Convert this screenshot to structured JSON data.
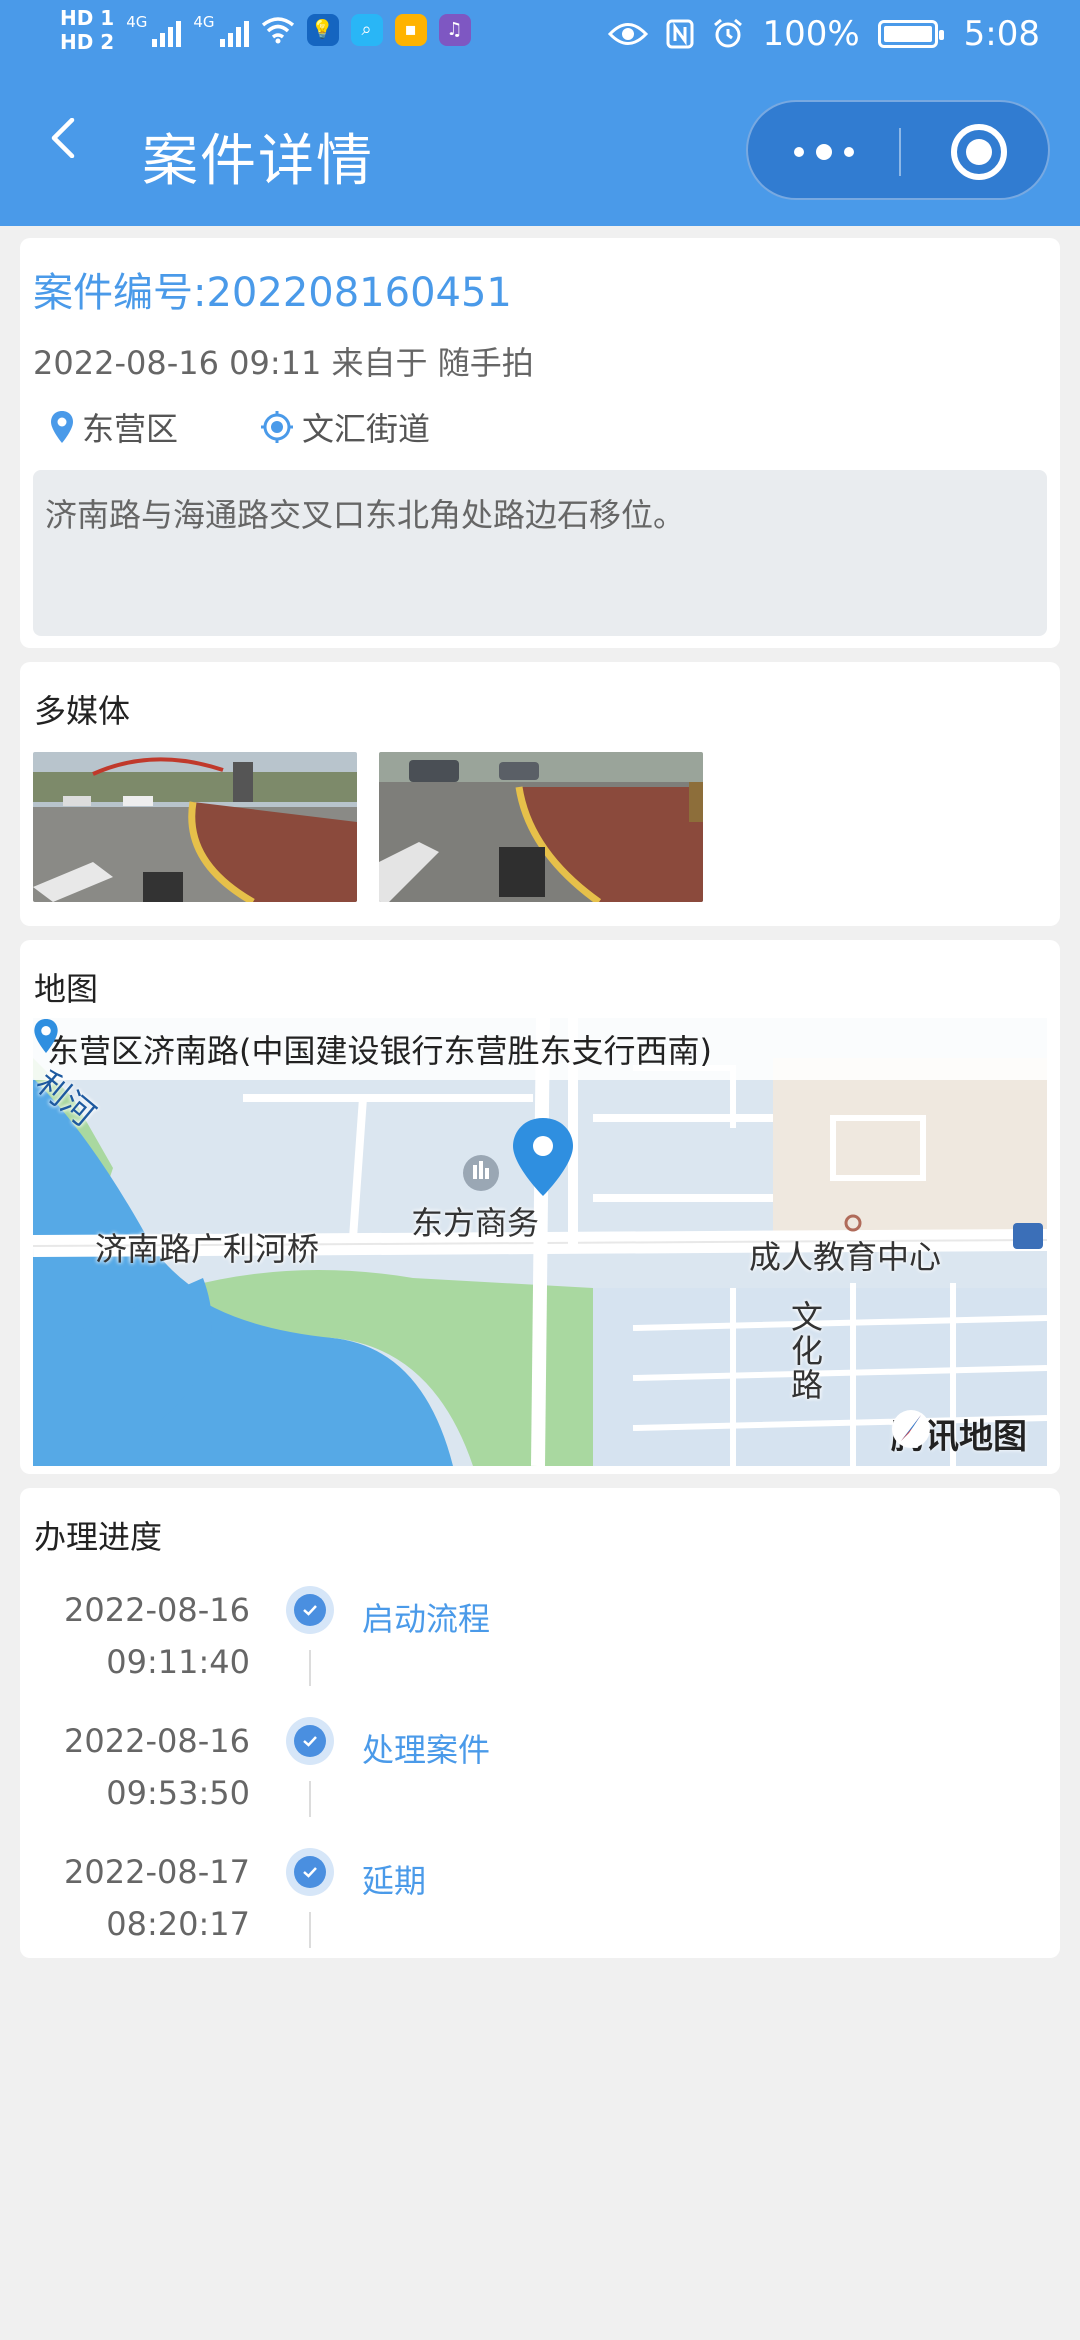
{
  "status_bar": {
    "hd1": "HD 1",
    "hd2": "HD 2",
    "net1": "4G",
    "net2": "4G",
    "battery": "100%",
    "time": "5:08"
  },
  "header": {
    "title": "案件详情"
  },
  "case": {
    "number": "案件编号:202208160451",
    "meta": "2022-08-16 09:11 来自于 随手拍",
    "district": "东营区",
    "street": "文汇街道",
    "description": "济南路与海通路交叉口东北角处路边石移位。"
  },
  "media": {
    "title": "多媒体"
  },
  "map": {
    "title": "地图",
    "address": "东营区济南路(中国建设银行东营胜东支行西南)",
    "labels": {
      "river": "利河",
      "poi": "东方商务",
      "bridge": "济南路广利河桥",
      "school": "成人教育中心",
      "road": "文化路"
    },
    "provider": "腾讯地图"
  },
  "progress": {
    "title": "办理进度",
    "steps": [
      {
        "date": "2022-08-16",
        "time": "09:11:40",
        "label": "启动流程"
      },
      {
        "date": "2022-08-16",
        "time": "09:53:50",
        "label": "处理案件"
      },
      {
        "date": "2022-08-17",
        "time": "08:20:17",
        "label": "延期"
      }
    ]
  },
  "colors": {
    "primary": "#4a9ae9",
    "background": "#f0f0f0"
  }
}
